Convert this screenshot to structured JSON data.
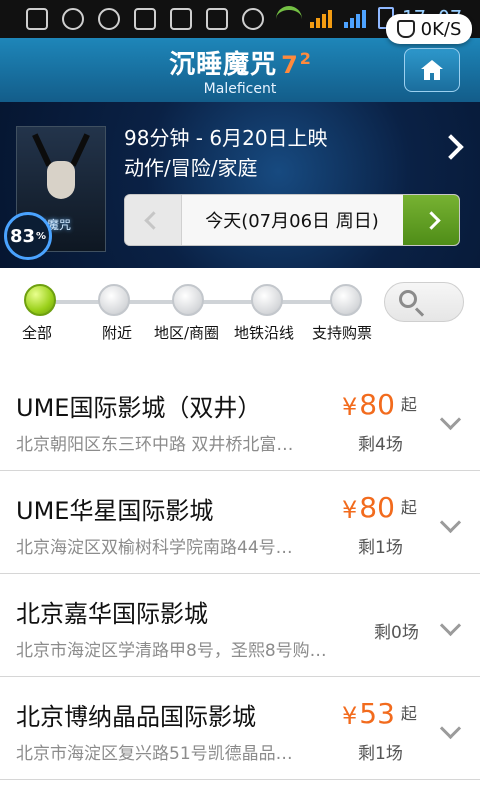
{
  "status": {
    "time": "17:07",
    "speed": "0K/S"
  },
  "header": {
    "title": "沉睡魔咒",
    "rating_main": "7",
    "rating_decimal": "2",
    "subtitle": "Maleficent"
  },
  "movie": {
    "poster_title": "沉睡魔咒",
    "progress_value": "83",
    "progress_suffix": "%",
    "meta_line1": "98分钟 - 6月20日上映",
    "meta_line2": "动作/冒险/家庭",
    "date_label": "今天(07月06日 周日)"
  },
  "filters": [
    "全部",
    "附近",
    "地区/商圈",
    "地铁沿线",
    "支持购票"
  ],
  "cinemas": [
    {
      "name": "UME国际影城（双井）",
      "address": "北京朝阳区东三环中路 双井桥北富…",
      "price_symbol": "¥",
      "price": "80",
      "price_suffix": "起",
      "remaining": "剩4场"
    },
    {
      "name": "UME华星国际影城",
      "address": "北京海淀区双榆树科学院南路44号…",
      "price_symbol": "¥",
      "price": "80",
      "price_suffix": "起",
      "remaining": "剩1场"
    },
    {
      "name": "北京嘉华国际影城",
      "address": "北京市海淀区学清路甲8号，圣熙8号购…",
      "price_symbol": "",
      "price": "",
      "price_suffix": "",
      "remaining": "剩0场"
    },
    {
      "name": "北京博纳晶品国际影城",
      "address": "北京市海淀区复兴路51号凯德晶品…",
      "price_symbol": "¥",
      "price": "53",
      "price_suffix": "起",
      "remaining": "剩1场"
    }
  ]
}
